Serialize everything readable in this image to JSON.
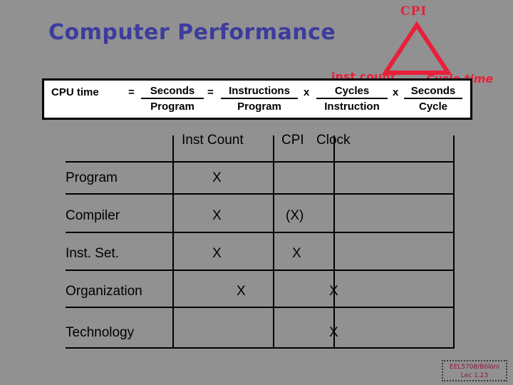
{
  "slide": {
    "title": "Computer Performance",
    "title_color": "#3c3c9e",
    "background_color": "#919191"
  },
  "annotation": {
    "accent_color": "#e8203a",
    "apex_label": "CPI",
    "left_label": "inst count",
    "right_label": "Cycle time",
    "shape": "triangle-icon"
  },
  "formula": {
    "lhs": "CPU time",
    "eq1": "=",
    "term1_numerator": "Seconds",
    "term1_denominator": "Program",
    "eq2": "=",
    "term2_numerator": "Instructions",
    "term2_denominator": "Program",
    "times1": "x",
    "term3_numerator": "Cycles",
    "term3_denominator": "Instruction",
    "times2": "x",
    "term4_numerator": "Seconds",
    "term4_denominator": "Cycle"
  },
  "matrix": {
    "columns": [
      "Inst Count",
      "CPI",
      "Clock"
    ],
    "rows": [
      {
        "label": "Program",
        "cells": [
          "X",
          "",
          ""
        ]
      },
      {
        "label": "Compiler",
        "cells": [
          "X",
          "(X)",
          ""
        ]
      },
      {
        "label": "Inst. Set.",
        "cells": [
          "X",
          "X",
          ""
        ]
      },
      {
        "label": "Organization",
        "cells": [
          "X",
          "X",
          ""
        ]
      },
      {
        "label": "Technology",
        "cells": [
          "",
          "X",
          ""
        ]
      }
    ]
  },
  "footer": {
    "line1": "EEL5708/Bölöni",
    "line2": "Lec  1.23",
    "color": "#8e1540"
  }
}
